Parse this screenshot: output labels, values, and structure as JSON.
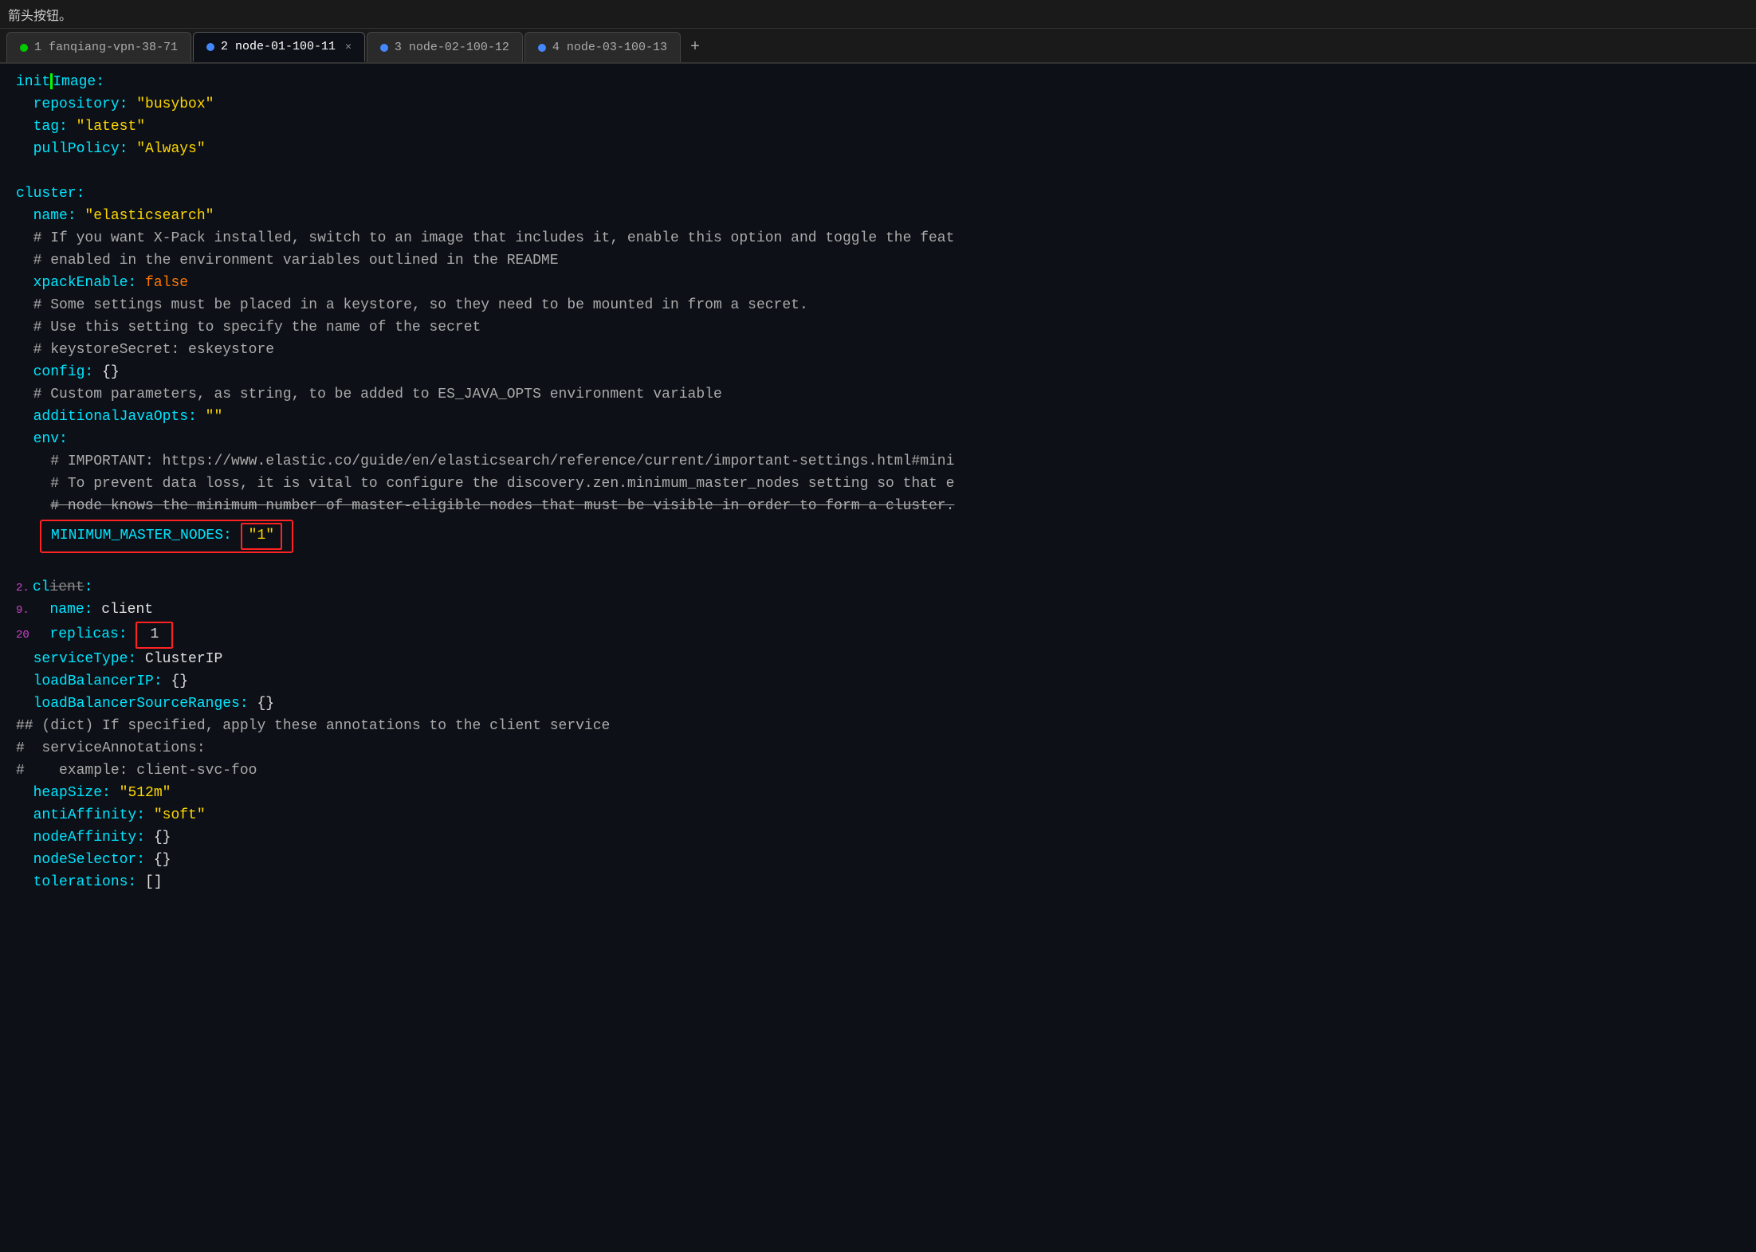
{
  "topbar": {
    "text": "箭头按钮。"
  },
  "tabs": [
    {
      "id": "tab1",
      "label": "1 fanqiang-vpn-38-71",
      "dot_color": "green",
      "active": false,
      "closable": false
    },
    {
      "id": "tab2",
      "label": "2 node-01-100-11",
      "dot_color": "blue",
      "active": true,
      "closable": true
    },
    {
      "id": "tab3",
      "label": "3 node-02-100-12",
      "dot_color": "blue",
      "active": false,
      "closable": false
    },
    {
      "id": "tab4",
      "label": "4 node-03-100-13",
      "dot_color": "blue",
      "active": false,
      "closable": false
    }
  ],
  "code": {
    "lines": [
      "initImage:",
      "  repository: \"busybox\"",
      "  tag: \"latest\"",
      "  pullPolicy: \"Always\"",
      "",
      "cluster:",
      "  name: \"elasticsearch\"",
      "  # If you want X-Pack installed, switch to an image that includes it, enable this option and toggle the feat",
      "  # enabled in the environment variables outlined in the README",
      "  xpackEnable: false",
      "  # Some settings must be placed in a keystore, so they need to be mounted in from a secret.",
      "  # Use this setting to specify the name of the secret",
      "  # keystoreSecret: eskeystore",
      "  config: {}",
      "  # Custom parameters, as string, to be added to ES_JAVA_OPTS environment variable",
      "  additionalJavaOpts: \"\"",
      "  env:",
      "    # IMPORTANT: https://www.elastic.co/guide/en/elasticsearch/reference/current/important-settings.html#mini",
      "    # To prevent data loss, it is vital to configure the discovery.zen.minimum_master_nodes setting so that e",
      "    # node knows the minimum number of master-eligible nodes that must be visible in order to form a cluster.",
      "    MINIMUM_MASTER_NODES: \"1\"",
      "",
      "client:",
      "  name: client",
      "  replicas: 1",
      "  serviceType: ClusterIP",
      "  loadBalancerIP: {}",
      "  loadBalancerSourceRanges: {}",
      "## (dict) If specified, apply these annotations to the client service",
      "#  serviceAnnotations:",
      "#    example: client-svc-foo",
      "  heapSize: \"512m\"",
      "  antiAffinity: \"soft\"",
      "  nodeAffinity: {}",
      "  nodeSelector: {}",
      "  tolerations: []"
    ]
  }
}
